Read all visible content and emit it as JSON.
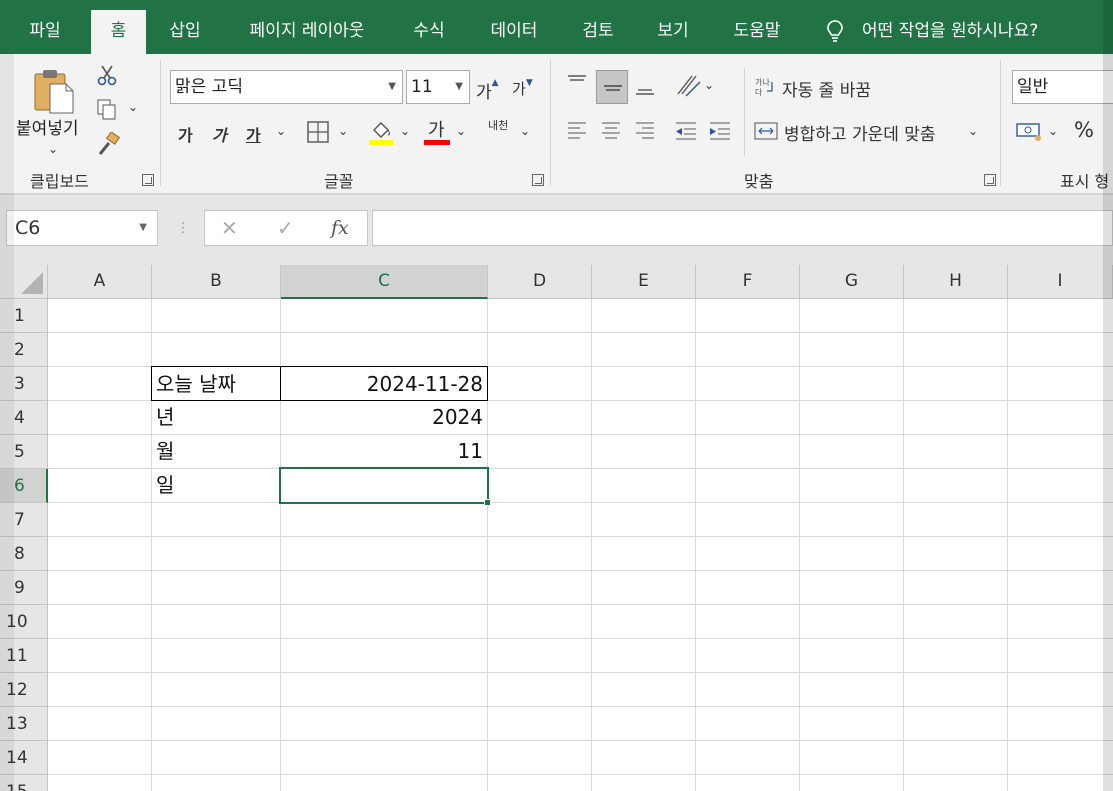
{
  "ribbon_tabs": [
    "파일",
    "홈",
    "삽입",
    "페이지 레이아웃",
    "수식",
    "데이터",
    "검토",
    "보기",
    "도움말"
  ],
  "active_tab": "홈",
  "tell_me": "어떤 작업을 원하시나요?",
  "clipboard": {
    "paste_label": "붙여넣기",
    "group_label": "클립보드"
  },
  "font": {
    "family": "맑은 고딕",
    "size": "11",
    "grow_label": "가",
    "shrink_label": "가",
    "bold_label": "가",
    "italic_label": "가",
    "underline_label": "가",
    "font_color_label": "가",
    "phonetic_label": "내천",
    "group_label": "글꼴",
    "highlight_color": "#ffff00",
    "font_color": "#ff0000"
  },
  "alignment": {
    "wrap_text_label": "자동 줄 바꿈",
    "merge_center_label": "병합하고 가운데 맞춤",
    "group_label": "맞춤"
  },
  "number": {
    "format": "일반",
    "percent_label": "%",
    "group_label": "표시 형"
  },
  "formula_bar": {
    "name_box": "C6",
    "cancel_symbol": "✕",
    "enter_symbol": "✓",
    "fx_label": "fx",
    "formula": ""
  },
  "columns": [
    "A",
    "B",
    "C",
    "D",
    "E",
    "F",
    "G",
    "H",
    "I"
  ],
  "selected_column": "C",
  "rows": [
    "1",
    "2",
    "3",
    "4",
    "5",
    "6",
    "7",
    "8",
    "9",
    "10",
    "11",
    "12",
    "13",
    "14",
    "15"
  ],
  "selected_row": "6",
  "cells": {
    "B3": "오늘 날짜",
    "C3": "2024-11-28",
    "B4": "년",
    "C4": "2024",
    "B5": "월",
    "C5": "11",
    "B6": "일",
    "C6": ""
  },
  "colors": {
    "accent": "#217346"
  }
}
